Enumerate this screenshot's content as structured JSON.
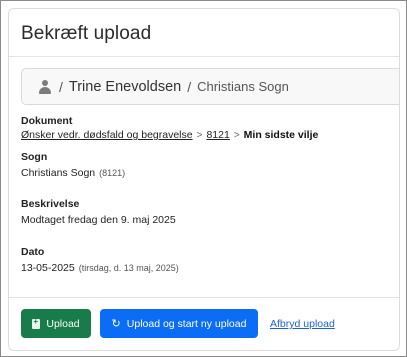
{
  "dialog": {
    "title": "Bekræft upload"
  },
  "breadcrumb": {
    "person": "Trine Enevoldsen",
    "separator": "/",
    "parish": "Christians Sogn"
  },
  "fields": {
    "document": {
      "label": "Dokument",
      "path": [
        "Ønsker vedr. dødsfald og begravelse",
        "8121"
      ],
      "separator": ">",
      "current": "Min sidste vilje"
    },
    "parish": {
      "label": "Sogn",
      "value": "Christians Sogn",
      "code": "(8121)"
    },
    "description": {
      "label": "Beskrivelse",
      "value": "Modtaget fredag den 9. maj 2025"
    },
    "date": {
      "label": "Dato",
      "value": "13-05-2025",
      "detail": "(tirsdag, d. 13 maj, 2025)"
    }
  },
  "actions": {
    "upload": "Upload",
    "upload_new": "Upload og start ny upload",
    "cancel": "Afbryd upload"
  },
  "colors": {
    "upload_button": "#177c4a",
    "upload_new_button": "#0b6cf5",
    "link": "#1f5fd6"
  },
  "icons": [
    "user-icon",
    "file-plus-icon",
    "refresh-icon",
    "chevron-right-icon"
  ]
}
